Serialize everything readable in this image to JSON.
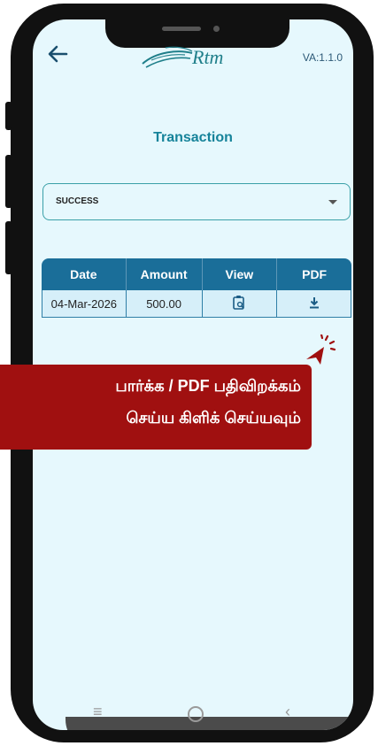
{
  "header": {
    "back_icon": "arrow-left-icon",
    "logo_text": "Rtm",
    "version": "VA:1.1.0"
  },
  "page": {
    "title": "Transaction"
  },
  "filter": {
    "selected": "SUCCESS"
  },
  "table": {
    "headers": [
      "Date",
      "Amount",
      "View",
      "PDF"
    ],
    "rows": [
      {
        "date": "04-Mar-2026",
        "amount": "500.00",
        "view_icon": "clipboard-search-icon",
        "pdf_icon": "download-icon"
      }
    ]
  },
  "callout": {
    "line1": "பார்க்க / PDF பதிவிறக்கம்",
    "line2": "செய்ய கிளிக் செய்யவும்",
    "color": "#a01010"
  },
  "colors": {
    "accent": "#16839a",
    "table_header": "#1a6e99",
    "screen_bg": "#e6f8fd"
  },
  "navbar": {
    "icons": [
      "menu-icon",
      "home-circle-icon",
      "back-chevron-icon"
    ]
  }
}
